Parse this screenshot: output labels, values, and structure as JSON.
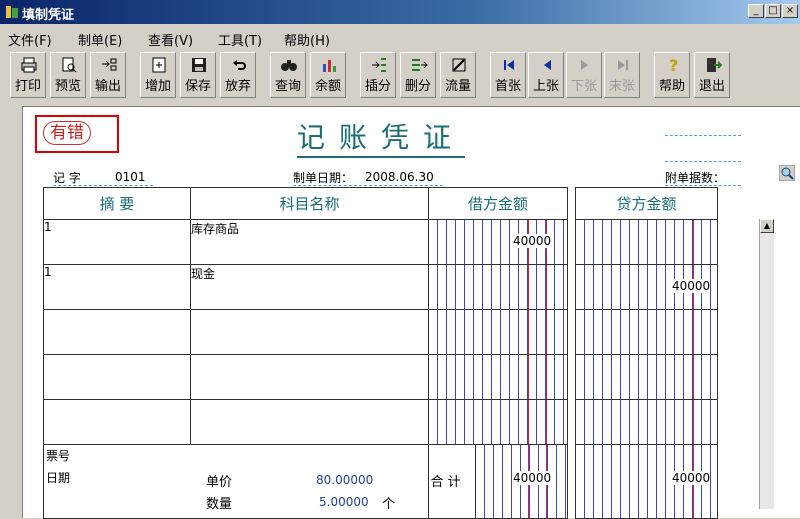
{
  "window": {
    "title": "填制凭证"
  },
  "menu": [
    "文件(F)",
    "制单(E)",
    "查看(V)",
    "工具(T)",
    "帮助(H)"
  ],
  "toolbar": [
    "打印",
    "预览",
    "输出",
    "增加",
    "保存",
    "放弃",
    "查询",
    "余额",
    "插分",
    "删分",
    "流量",
    "首张",
    "上张",
    "下张",
    "末张",
    "帮助",
    "退出"
  ],
  "voucher": {
    "status": "有错",
    "title": "记账凭证",
    "type_label": "记 字",
    "number": "0101",
    "date_label": "制单日期：",
    "date": "2008.06.30",
    "attach_label": "附单据数："
  },
  "table": {
    "headers": [
      "摘 要",
      "科目名称",
      "借方金额",
      "贷方金额"
    ],
    "rows": [
      {
        "summary": "1",
        "account": "库存商品",
        "debit": "40000",
        "credit": ""
      },
      {
        "summary": "1",
        "account": "现金",
        "debit": "",
        "credit": "40000"
      },
      {
        "summary": "",
        "account": "",
        "debit": "",
        "credit": ""
      },
      {
        "summary": "",
        "account": "",
        "debit": "",
        "credit": ""
      },
      {
        "summary": "",
        "account": "",
        "debit": "",
        "credit": ""
      }
    ],
    "footer": {
      "ticket_label": "票号",
      "date_label": "日期",
      "price_label": "单价",
      "price": "80.00000",
      "qty_label": "数量",
      "qty": "5.00000",
      "qty_unit": "个",
      "total_label": "合 计",
      "total_debit": "40000",
      "total_credit": "40000"
    }
  }
}
